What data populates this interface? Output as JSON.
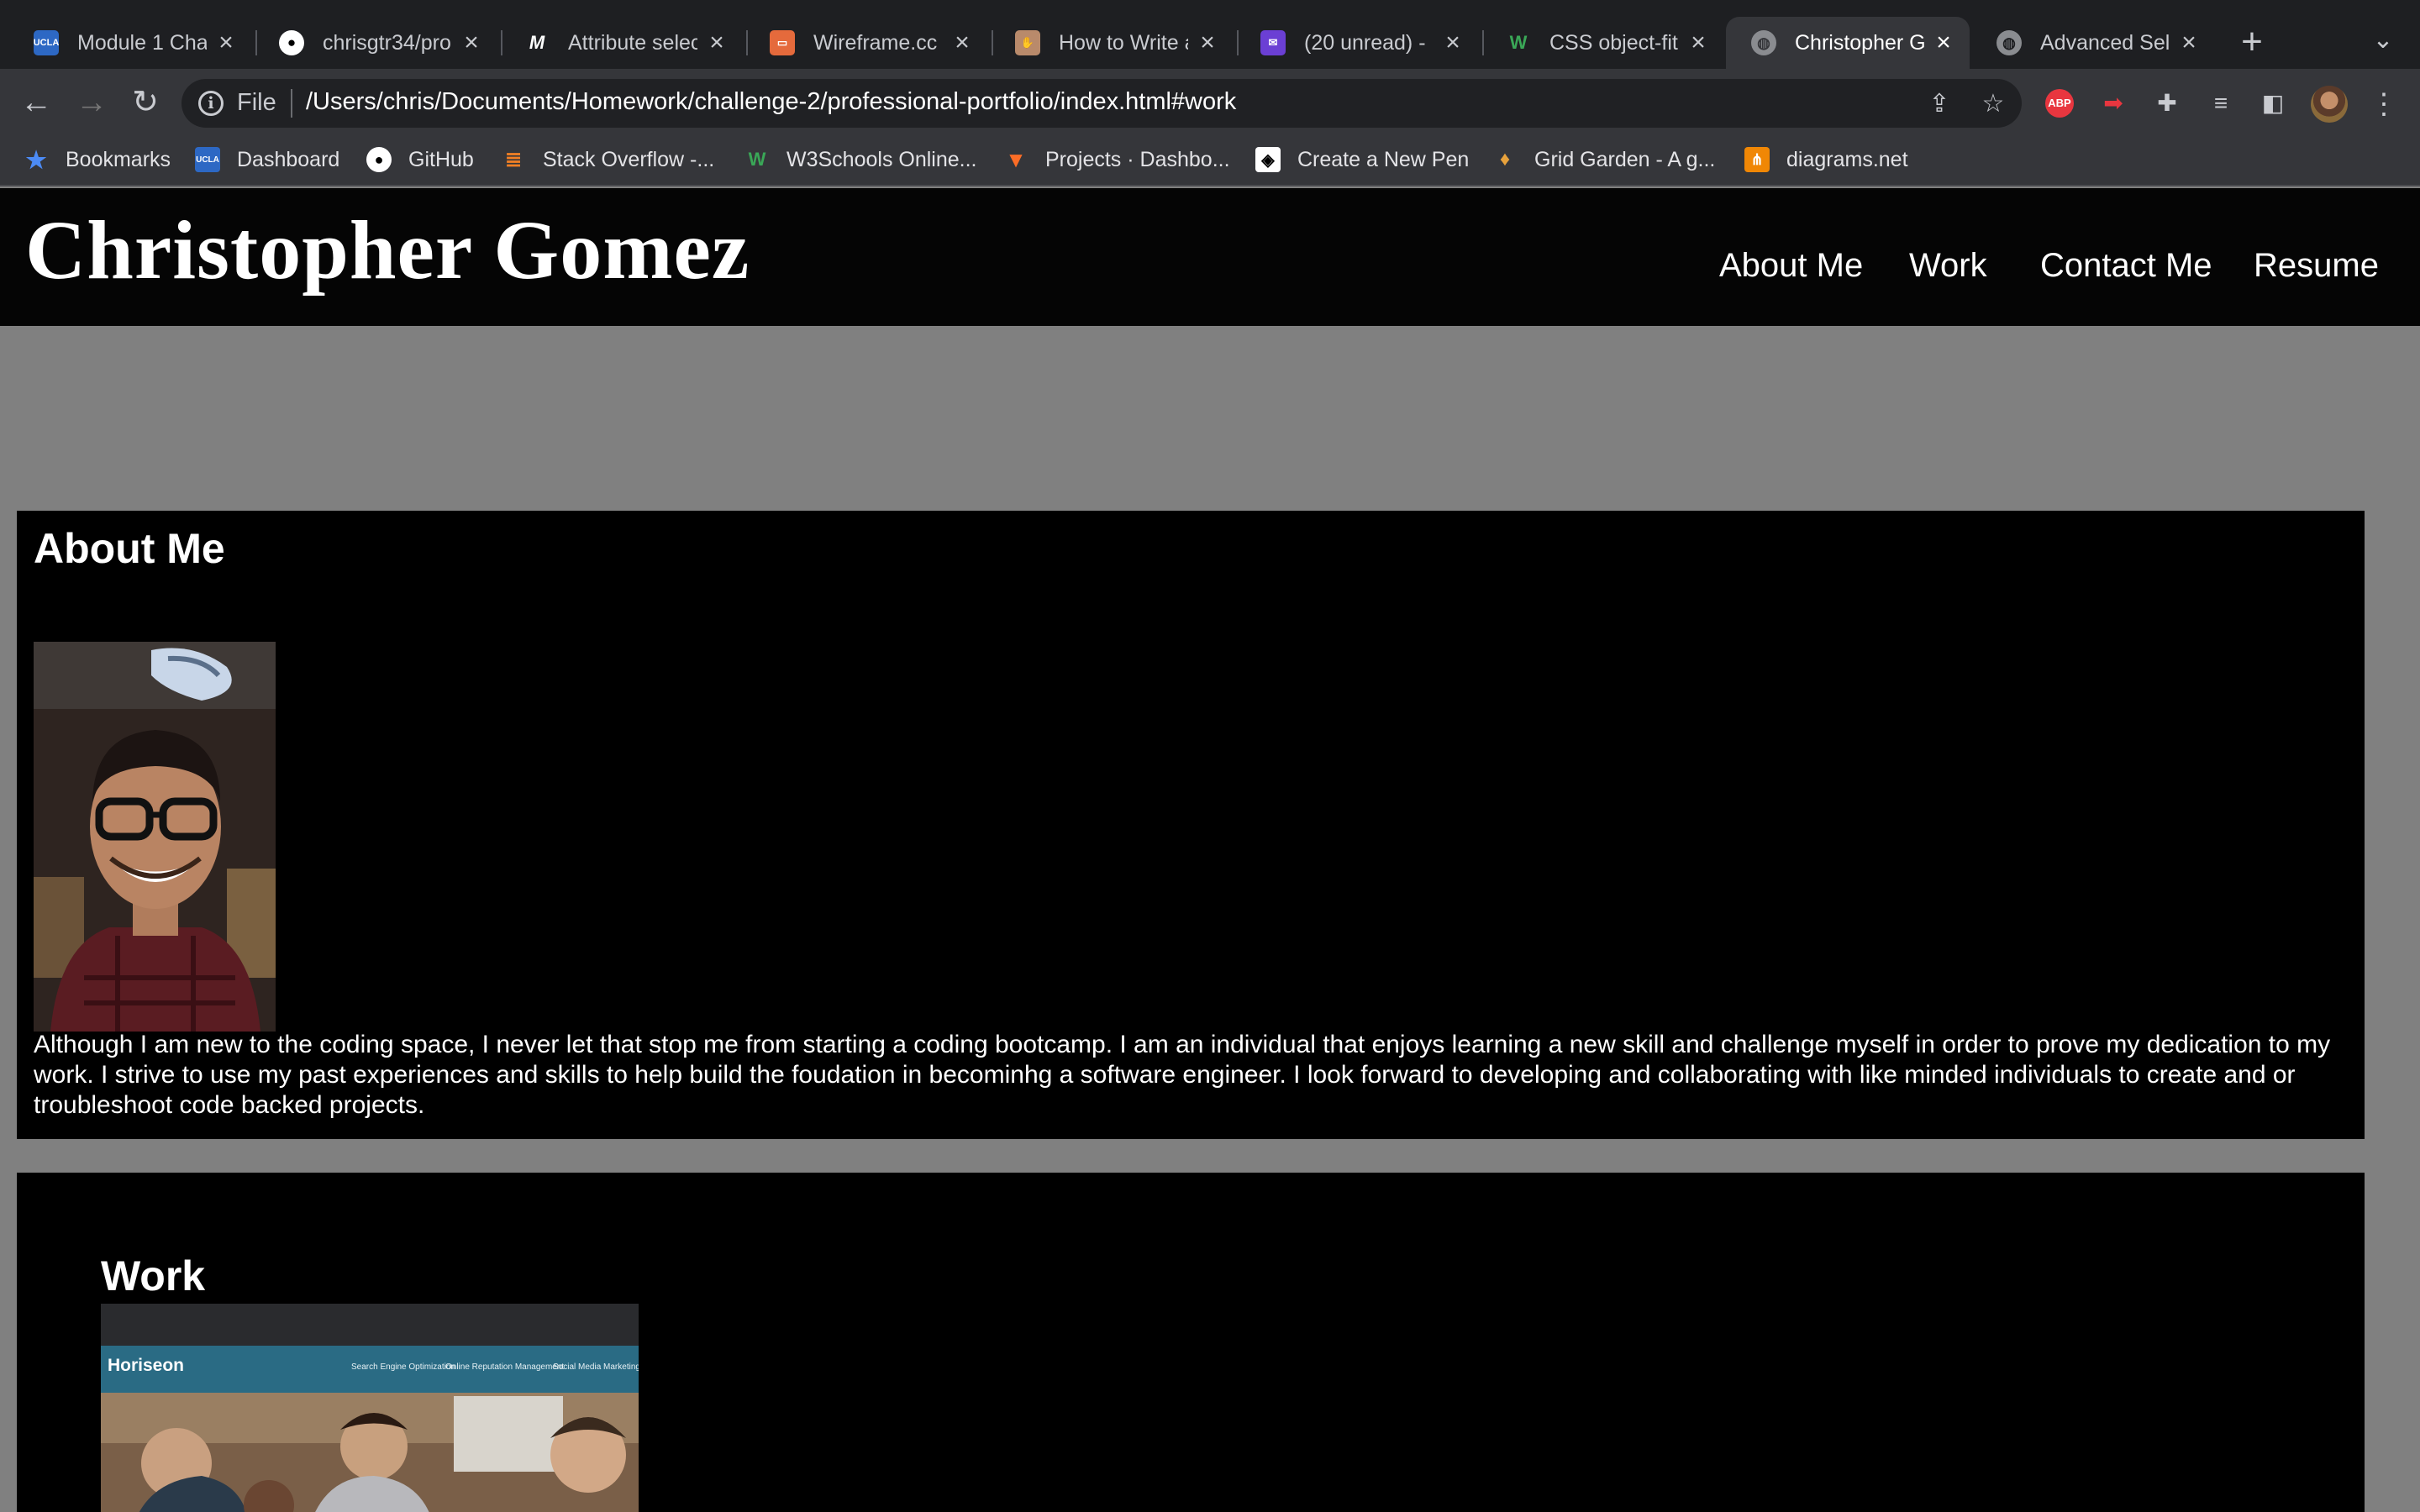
{
  "browser": {
    "tabs": [
      {
        "title": "Module 1 Chal",
        "icon": "ucla-icon"
      },
      {
        "title": "chrisgtr34/pro",
        "icon": "github-icon"
      },
      {
        "title": "Attribute selec",
        "icon": "mdn-icon"
      },
      {
        "title": "Wireframe.cc",
        "icon": "wireframe-icon"
      },
      {
        "title": "How to Write a",
        "icon": "hashnode-icon"
      },
      {
        "title": "(20 unread) -",
        "icon": "mail-icon"
      },
      {
        "title": "CSS object-fit",
        "icon": "w3schools-icon"
      },
      {
        "title": "Christopher G",
        "icon": "globe-icon"
      },
      {
        "title": "Advanced Sel",
        "icon": "globe-icon"
      }
    ],
    "address": {
      "scheme_label": "File",
      "url": "/Users/chris/Documents/Homework/challenge-2/professional-portfolio/index.html#work"
    },
    "extensions": {
      "abp_label": "ABP"
    },
    "bookmarks": [
      {
        "label": "Bookmarks",
        "icon": "star-icon"
      },
      {
        "label": "Dashboard",
        "icon": "ucla-icon"
      },
      {
        "label": "GitHub",
        "icon": "github-icon"
      },
      {
        "label": "Stack Overflow -...",
        "icon": "stackoverflow-icon"
      },
      {
        "label": "W3Schools Online...",
        "icon": "w3schools-icon"
      },
      {
        "label": "Projects · Dashbo...",
        "icon": "gitlab-icon"
      },
      {
        "label": "Create a New Pen",
        "icon": "codepen-icon"
      },
      {
        "label": "Grid Garden - A g...",
        "icon": "carrot-icon"
      },
      {
        "label": "diagrams.net",
        "icon": "diagrams-icon"
      }
    ]
  },
  "site": {
    "title": "Christopher Gomez",
    "nav": [
      "About Me",
      "Work",
      "Contact Me",
      "Resume"
    ],
    "about": {
      "heading": "About Me",
      "text": "Although I am new to the coding space, I never let that stop me from starting a coding bootcamp. I am an individual that enjoys learning a new skill and challenge myself in order to prove my dedication to my work. I strive to use my past experiences and skills to help build the foudation in becominhg a software engineer. I look forward to developing and collaborating with like minded individuals to create and or troubleshoot code backed projects."
    },
    "work": {
      "heading": "Work",
      "screenshot": {
        "brand": "Horiseon",
        "links": [
          "Search Engine Optimization",
          "Online Reputation Management",
          "Social Media Marketing"
        ]
      }
    }
  }
}
